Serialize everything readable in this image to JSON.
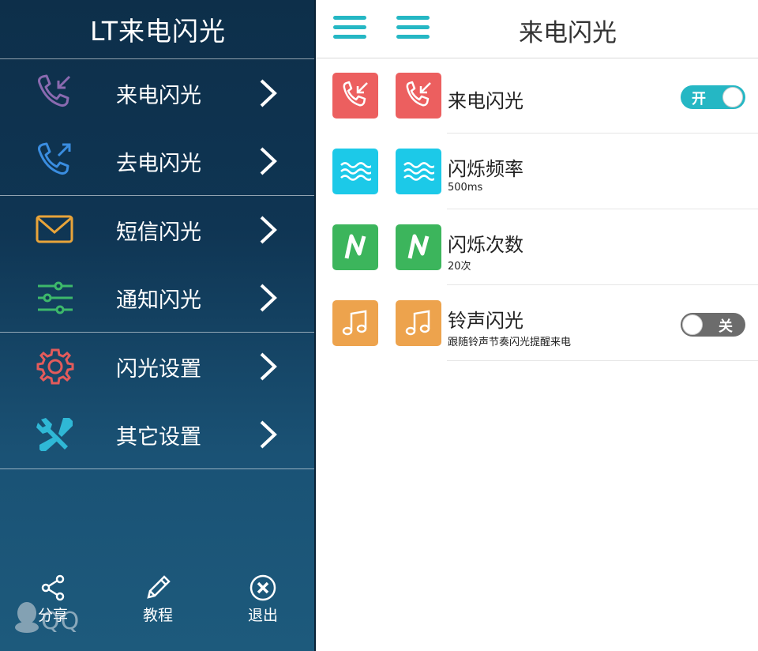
{
  "drawer": {
    "title": "LT来电闪光",
    "items": [
      {
        "label": "来电闪光",
        "icon": "incoming-call-icon",
        "color": "#8a6ab0"
      },
      {
        "label": "去电闪光",
        "icon": "outgoing-call-icon",
        "color": "#3a8de0"
      },
      {
        "label": "短信闪光",
        "icon": "envelope-icon",
        "color": "#e8a43a"
      },
      {
        "label": "通知闪光",
        "icon": "sliders-icon",
        "color": "#3db86b"
      },
      {
        "label": "闪光设置",
        "icon": "gear-icon",
        "color": "#e35b5b"
      },
      {
        "label": "其它设置",
        "icon": "tools-icon",
        "color": "#2fb8d6"
      }
    ],
    "footer": {
      "share": "分享",
      "tutorial": "教程",
      "exit": "退出"
    },
    "watermark": "QQ"
  },
  "header": {
    "title": "来电闪光"
  },
  "settings": [
    {
      "title": "来电闪光",
      "subtitle": "",
      "icon": "incoming-call-icon",
      "color": "#ec5f5f",
      "toggle": {
        "state": "on",
        "label": "开"
      }
    },
    {
      "title": "闪烁频率",
      "subtitle": "500ms",
      "icon": "waves-icon",
      "color": "#1cc9e8"
    },
    {
      "title": "闪烁次数",
      "subtitle": "20次",
      "icon": "letter-n-icon",
      "color": "#3cb55c"
    },
    {
      "title": "铃声闪光",
      "subtitle": "跟随铃声节奏闪光提醒来电",
      "icon": "music-note-icon",
      "color": "#eda34d",
      "toggle": {
        "state": "off",
        "label": "关"
      }
    }
  ],
  "colors": {
    "accent": "#25b7c4",
    "toggle_on": "#25b7c4",
    "toggle_off": "#6c6c6c"
  }
}
